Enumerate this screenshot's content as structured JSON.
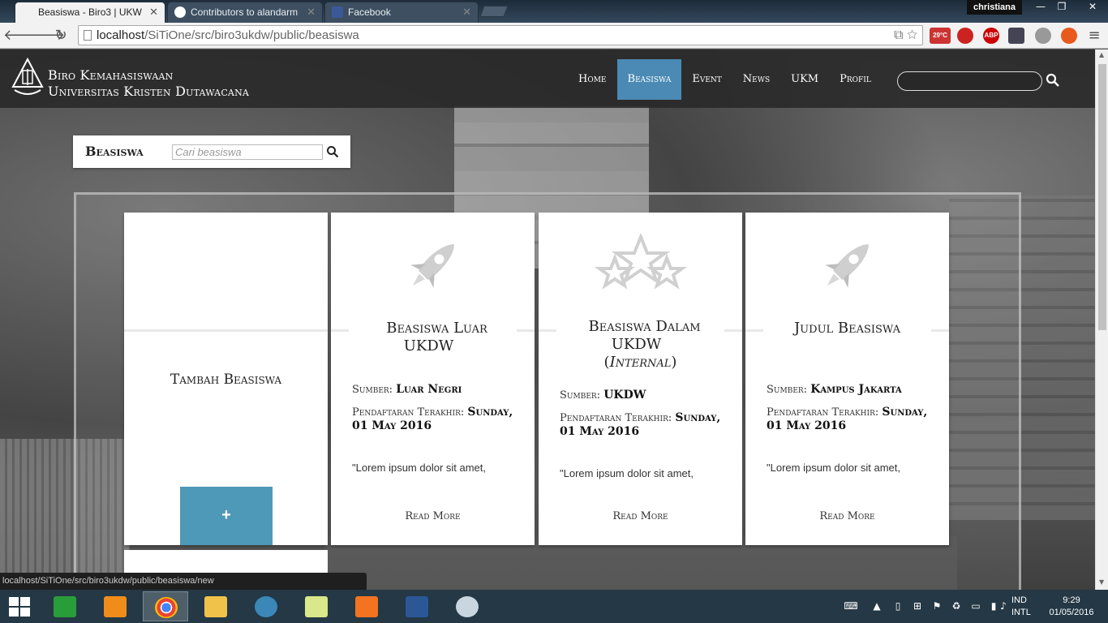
{
  "browser": {
    "tabs": [
      {
        "title": "Beasiswa - Biro3 | UKW",
        "active": true
      },
      {
        "title": "Contributors to alandarm",
        "active": false
      },
      {
        "title": "Facebook",
        "active": false
      }
    ],
    "user": "christiana",
    "url_prefix": "localhost",
    "url_path": "/SiTiOne/src/biro3ukdw/public/beasiswa",
    "weather_temp": "29°C",
    "abp_label": "ABP",
    "status_url": "localhost/SiTiOne/src/biro3ukdw/public/beasiswa/new"
  },
  "site": {
    "brand_line1": "Biro Kemahasiswaan",
    "brand_line2": "Universitas Kristen Dutawacana",
    "nav": [
      "Home",
      "Beasiswa",
      "Event",
      "News",
      "UKM",
      "Profil"
    ],
    "active_nav": "Beasiswa"
  },
  "panel": {
    "title": "Beasiswa",
    "search_placeholder": "Cari beasiswa"
  },
  "add_card": {
    "title": "Tambah Beasiswa",
    "button": "+"
  },
  "cards": [
    {
      "icon": "rocket-icon",
      "title": "Beasiswa Luar UKDW",
      "sumber_label": "Sumber",
      "sumber": "Luar Negri",
      "deadline_label": "Pendaftaran Terakhir",
      "deadline": "Sunday, 01 May 2016",
      "excerpt": "\"Lorem ipsum dolor sit amet,",
      "read_more": "Read More"
    },
    {
      "icon": "stars-icon",
      "title": "Beasiswa Dalam UKDW",
      "subtitle": "Internal",
      "sumber_label": "Sumber",
      "sumber": "UKDW",
      "deadline_label": "Pendaftaran Terakhir",
      "deadline": "Sunday, 01 May 2016",
      "excerpt": "\"Lorem ipsum dolor sit amet,",
      "read_more": "Read More"
    },
    {
      "icon": "rocket-icon",
      "title": "Judul Beasiswa",
      "sumber_label": "Sumber",
      "sumber": "Kampus Jakarta",
      "deadline_label": "Pendaftaran Terakhir",
      "deadline": "Sunday, 01 May 2016",
      "excerpt": "\"Lorem ipsum dolor sit amet,",
      "read_more": "Read More"
    }
  ],
  "taskbar": {
    "lang_1": "IND",
    "lang_2": "INTL",
    "time": "9:29",
    "date": "01/05/2016"
  },
  "colors": {
    "accent": "#4a8ab4",
    "add_button": "#4e98b8",
    "taskbar": "#243845"
  }
}
